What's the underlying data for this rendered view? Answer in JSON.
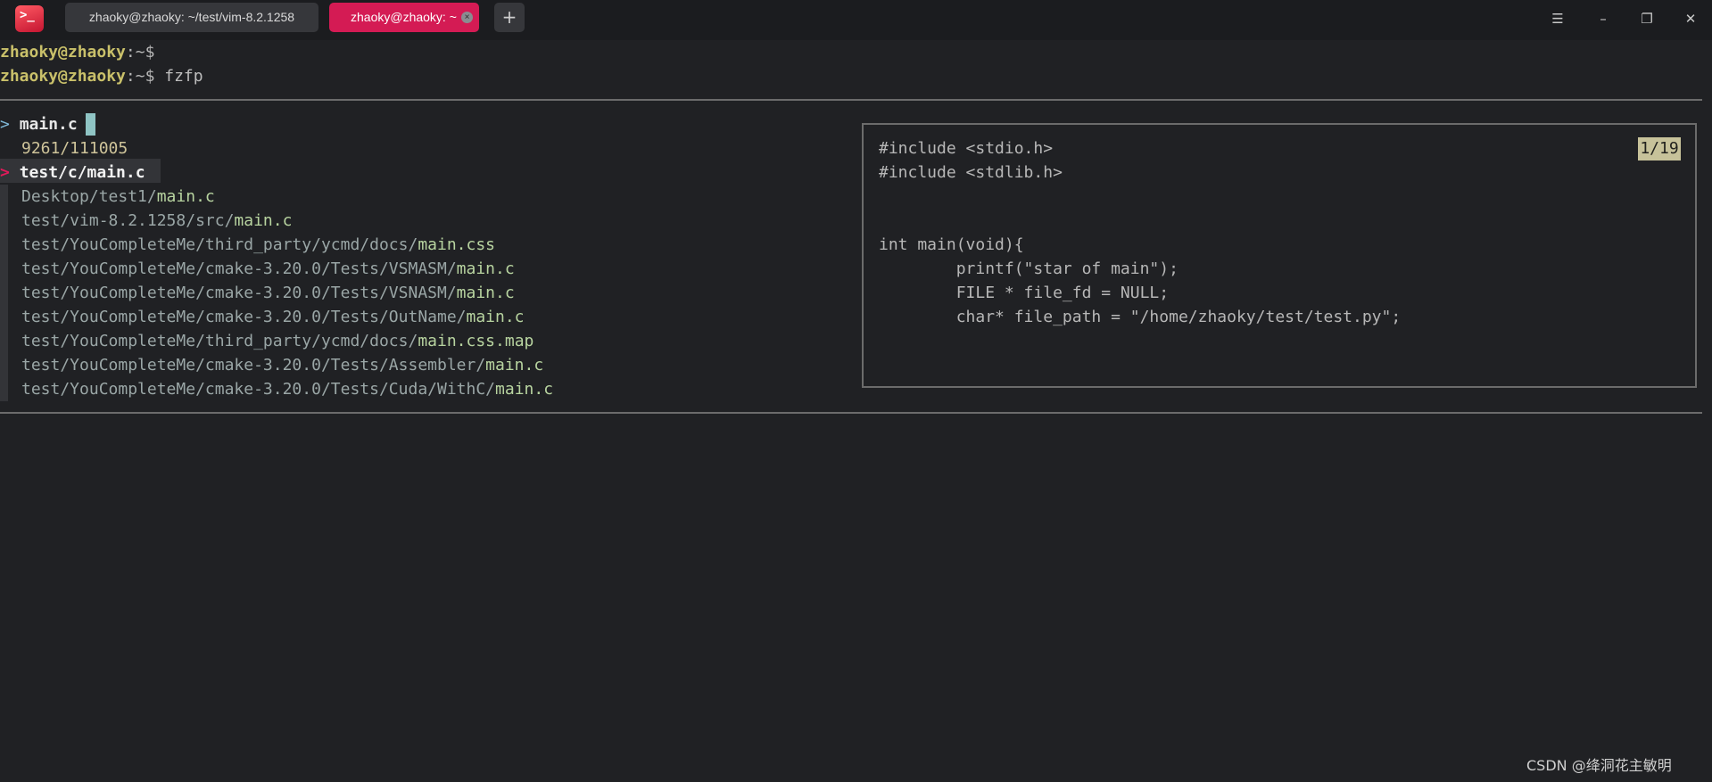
{
  "titlebar": {
    "tabs": [
      {
        "label": "zhaoky@zhaoky: ~/test/vim-8.2.1258"
      },
      {
        "label": "zhaoky@zhaoky: ~"
      }
    ],
    "close_tab_glyph": "×",
    "add_tab_glyph": "+",
    "window_controls": {
      "menu": "☰",
      "minimize": "–",
      "restore": "❐",
      "close": "✕"
    }
  },
  "terminal": {
    "prompt_user": "zhaoky@zhaoky",
    "prompt_suffix": ":~$",
    "command": " fzfp",
    "fzf": {
      "query_arrow": ">",
      "query": "main.c",
      "match_count": "9261/111005",
      "selected_arrow": ">",
      "selected_item": "test/c/main.c",
      "items": [
        {
          "path": "Desktop/test1/",
          "match": "main.c"
        },
        {
          "path": "test/vim-8.2.1258/src/",
          "match": "main.c"
        },
        {
          "path": "test/YouCompleteMe/third_party/ycmd/docs/",
          "match": "main.css"
        },
        {
          "path": "test/YouCompleteMe/cmake-3.20.0/Tests/VSMASM/",
          "match": "main.c"
        },
        {
          "path": "test/YouCompleteMe/cmake-3.20.0/Tests/VSNASM/",
          "match": "main.c"
        },
        {
          "path": "test/YouCompleteMe/cmake-3.20.0/Tests/OutName/",
          "match": "main.c"
        },
        {
          "path": "test/YouCompleteMe/third_party/ycmd/docs/",
          "match": "main.css.map"
        },
        {
          "path": "test/YouCompleteMe/cmake-3.20.0/Tests/Assembler/",
          "match": "main.c"
        },
        {
          "path": "test/YouCompleteMe/cmake-3.20.0/Tests/Cuda/WithC/",
          "match": "main.c"
        }
      ],
      "preview": {
        "position": "1/19",
        "lines": [
          "#include <stdio.h>",
          "#include <stdlib.h>",
          "",
          "",
          "int main(void){",
          "        printf(\"star of main\");",
          "        FILE * file_fd = NULL;",
          "        char* file_path = \"/home/zhaoky/test/test.py\";"
        ]
      }
    }
  },
  "watermark": "CSDN @绛洞花主敏明",
  "colors": {
    "background": "#202124",
    "titlebar": "#1b1c1f",
    "active_tab": "#d41b54",
    "prompt": "#c9c06a",
    "selection_arrow": "#e21a5a",
    "match": "#b8d4a0"
  }
}
